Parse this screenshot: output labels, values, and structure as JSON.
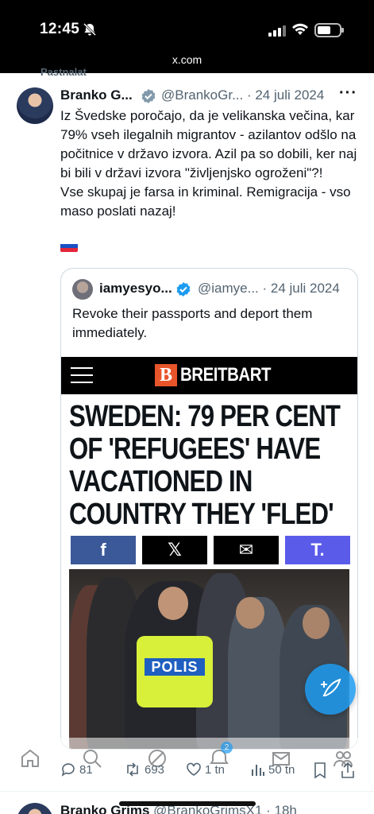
{
  "status": {
    "time": "12:45",
    "url": "x.com"
  },
  "tweet": {
    "pinned_label": "Pastnalat",
    "author_name": "Branko G...",
    "author_handle": "@BrankoGr... · 24 juli 2024",
    "more": "···",
    "text_lines": [
      "Iz Švedske poročajo, da je velikanska večina, kar 79% vseh ilegalnih migrantov - azilantov odšlo na počitnice v državo izvora. Azil pa so dobili, ker naj bi bili v državi izvora \"življenjsko ogroženi\"?!",
      "Vse skupaj je farsa in kriminal. Remigracija - vso maso poslati nazaj!"
    ],
    "flag": {
      "colors": [
        "#ffffff",
        "#1c4fc4",
        "#e3263a"
      ]
    },
    "quote": {
      "author_name": "iamyesyo...",
      "author_handle": "@iamye... · 24 juli 2024",
      "text": "Revoke their passports and deport them immediately.",
      "media": {
        "brand_letter": "B",
        "brand_name": "BREITBART",
        "headline": "SWEDEN: 79 PER CENT OF 'REFUGEES' HAVE VACATIONED IN COUNTRY THEY 'FLED'",
        "share_buttons": [
          {
            "label": "f",
            "color": "#3b5998",
            "icon": "facebook-icon"
          },
          {
            "label": "𝕏",
            "color": "#000000",
            "icon": "x-icon"
          },
          {
            "label": "✉",
            "color": "#000000",
            "icon": "mail-icon"
          },
          {
            "label": "T.",
            "color": "#5b5bea",
            "icon": "truth-social-icon"
          }
        ],
        "photo_badge": "POLIS"
      }
    },
    "actions": {
      "replies": "81",
      "reposts": "693",
      "likes": "1 tn",
      "views": "50 tn"
    },
    "notification_badge": "2"
  },
  "next_tweet": {
    "author_name": "Branko Grims",
    "author_handle": "@BrankoGrimsX1 · 18h"
  }
}
